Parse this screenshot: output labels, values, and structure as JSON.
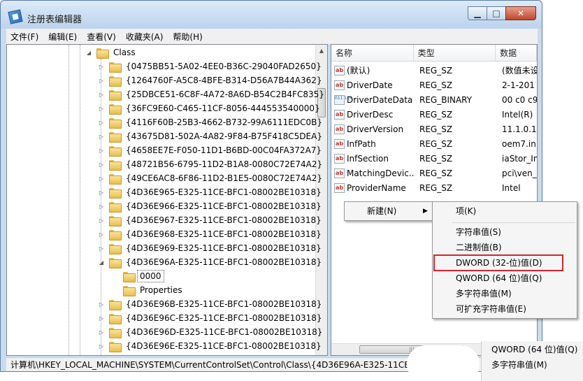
{
  "window": {
    "title": "注册表编辑器",
    "controls": {
      "minimize": "▁",
      "maximize": "□",
      "close": "✕"
    }
  },
  "menubar": [
    "文件(F)",
    "编辑(E)",
    "查看(V)",
    "收藏夹(A)",
    "帮助(H)"
  ],
  "tree": {
    "class_label": "Class",
    "keys_before": [
      "{0475BB51-5A02-4EE0-B36C-29040FAD2650}",
      "{1264760F-A5C8-4BFE-B314-D56A7B44A362}",
      "{25DBCE51-6C8F-4A72-8A6D-B54C2B4FC835}",
      "{36FC9E60-C465-11CF-8056-444553540000}",
      "{4116F60B-25B3-4662-B732-99A6111EDC0B}",
      "{43675D81-502A-4A82-9F84-B75F418C5DEA}",
      "{4658EE7E-F050-11D1-B6BD-00C04FA372A7}",
      "{48721B56-6795-11D2-B1A8-0080C72E74A2}",
      "{49CE6AC8-6F86-11D2-B1E5-0080C72E74A2}",
      "{4D36E965-E325-11CE-BFC1-08002BE10318}",
      "{4D36E966-E325-11CE-BFC1-08002BE10318}",
      "{4D36E967-E325-11CE-BFC1-08002BE10318}",
      "{4D36E968-E325-11CE-BFC1-08002BE10318}",
      "{4D36E969-E325-11CE-BFC1-08002BE10318}"
    ],
    "expanded_key": "{4D36E96A-E325-11CE-BFC1-08002BE10318}",
    "children": [
      "0000",
      "Properties"
    ],
    "keys_after": [
      "{4D36E96B-E325-11CE-BFC1-08002BE10318}",
      "{4D36E96C-E325-11CE-BFC1-08002BE10318}",
      "{4D36E96D-E325-11CE-BFC1-08002BE10318}",
      "{4D36E96E-E325-11CE-BFC1-08002BE10318}"
    ]
  },
  "list": {
    "columns": [
      "名称",
      "类型",
      "数据"
    ],
    "rows": [
      {
        "icon": "string-value-icon",
        "name": "(默认)",
        "type": "REG_SZ",
        "data": "(数值未设"
      },
      {
        "icon": "string-value-icon",
        "name": "DriverDate",
        "type": "REG_SZ",
        "data": "2-1-201"
      },
      {
        "icon": "binary-value-icon",
        "name": "DriverDateData",
        "type": "REG_BINARY",
        "data": "00 c0 c9"
      },
      {
        "icon": "string-value-icon",
        "name": "DriverDesc",
        "type": "REG_SZ",
        "data": "Intel(R)"
      },
      {
        "icon": "string-value-icon",
        "name": "DriverVersion",
        "type": "REG_SZ",
        "data": "11.1.0.1"
      },
      {
        "icon": "string-value-icon",
        "name": "InfPath",
        "type": "REG_SZ",
        "data": "oem7.in"
      },
      {
        "icon": "string-value-icon",
        "name": "InfSection",
        "type": "REG_SZ",
        "data": "iaStor_In"
      },
      {
        "icon": "string-value-icon",
        "name": "MatchingDevic...",
        "type": "REG_SZ",
        "data": "pci\\ven_"
      },
      {
        "icon": "string-value-icon",
        "name": "ProviderName",
        "type": "REG_SZ",
        "data": "Intel"
      }
    ]
  },
  "context_menu": {
    "new_label": "新建(N)",
    "submenu": {
      "key": "项(K)",
      "items": [
        "字符串值(S)",
        "二进制值(B)",
        "DWORD (32-位)值(D)",
        "QWORD (64 位)值(Q)",
        "多字符串值(M)",
        "可扩充字符串值(E)"
      ]
    },
    "highlight_color": "#d9232e"
  },
  "statusbar": {
    "path": "计算机\\HKEY_LOCAL_MACHINE\\SYSTEM\\CurrentControlSet\\Control\\Class\\{4D36E96A-E325-11CE-"
  },
  "bleed": [
    "QWORD (64 位)值(Q)",
    "多字符串值(M)"
  ]
}
